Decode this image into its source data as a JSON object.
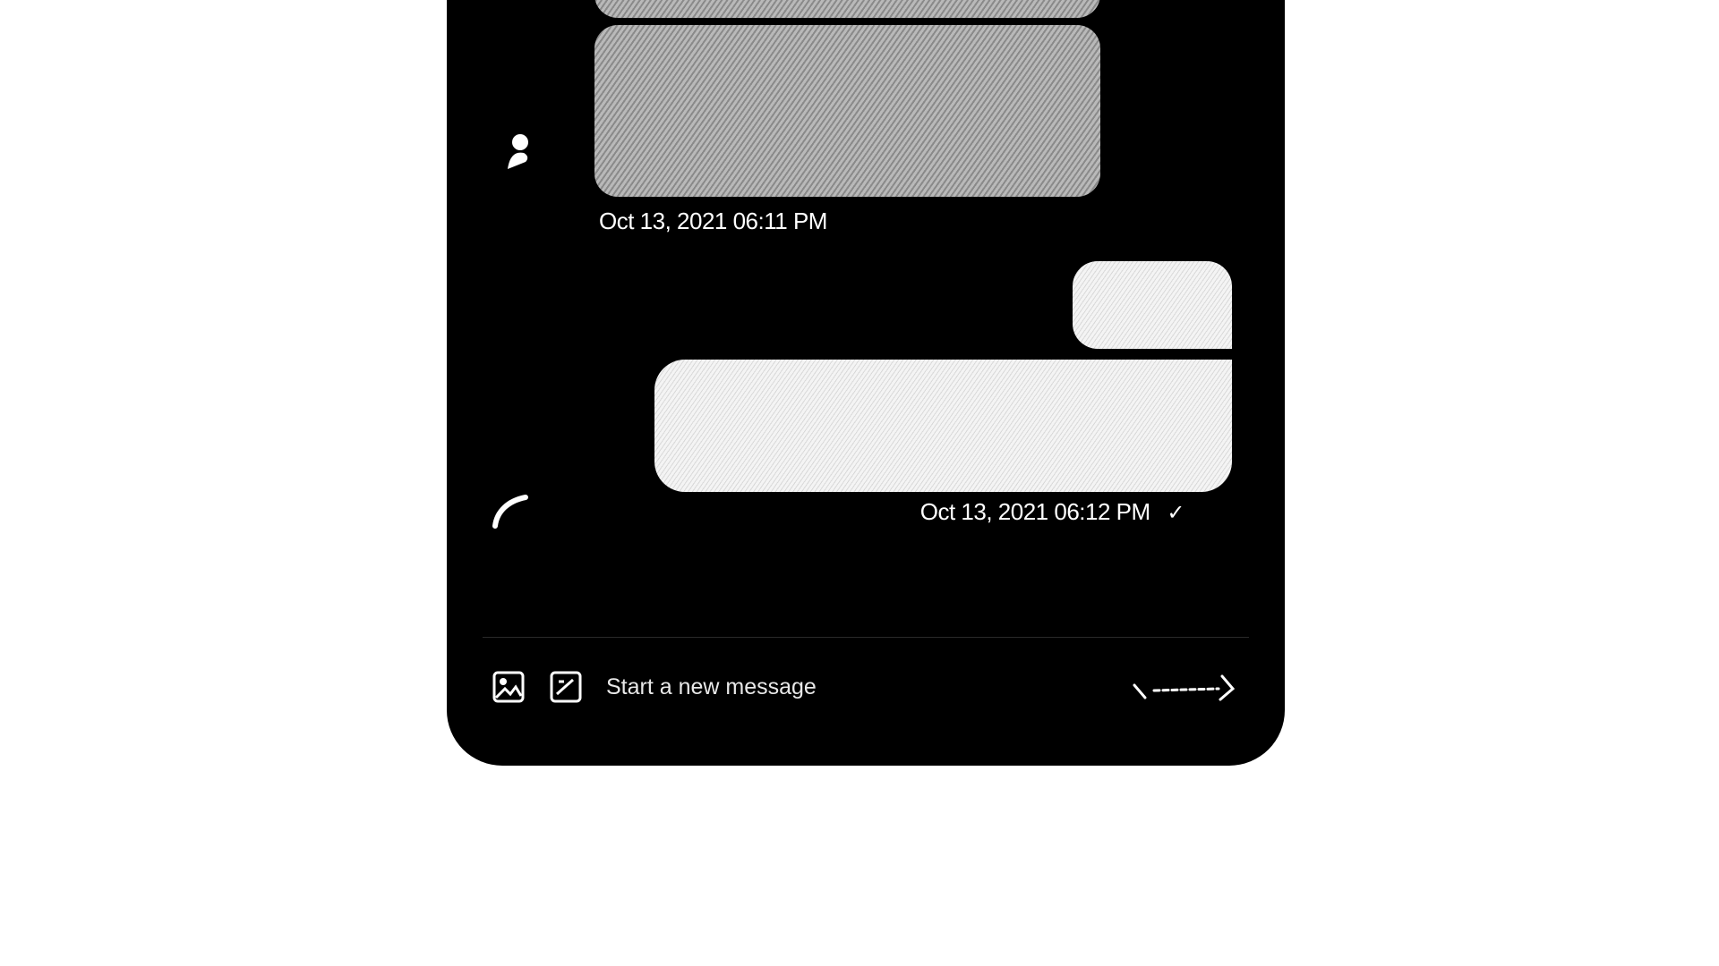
{
  "messages": [
    {
      "direction": "received",
      "timestamp": "Oct 13, 2021 06:11 PM"
    },
    {
      "direction": "sent",
      "timestamp": "Oct 13, 2021 06:12 PM",
      "status_icon": "checkmark-icon"
    }
  ],
  "composer": {
    "placeholder": "Start a new message",
    "left_icons": [
      "media-icon",
      "gif-icon"
    ],
    "send_icon": "send-icon"
  },
  "colors": {
    "panel_background": "#000000",
    "page_background": "#ffffff",
    "text": "#ffffff"
  }
}
